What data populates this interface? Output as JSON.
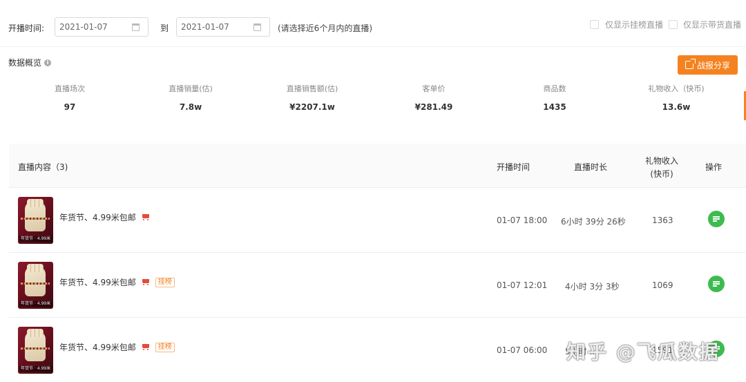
{
  "filters": {
    "start_label": "开播时间:",
    "start_date": "2021-01-07",
    "to_label": "到",
    "end_date": "2021-01-07",
    "hint": "(请选择近6个月内的直播)",
    "checkbox_1": "仅显示挂榜直播",
    "checkbox_2": "仅显示带货直播"
  },
  "overview": {
    "title": "数据概览",
    "share_label": "战报分享",
    "stats": [
      {
        "label": "直播场次",
        "value": "97"
      },
      {
        "label": "直播销量(估)",
        "value": "7.8w"
      },
      {
        "label": "直播销售额(估)",
        "value": "¥2207.1w"
      },
      {
        "label": "客单价",
        "value": "¥281.49"
      },
      {
        "label": "商品数",
        "value": "1435"
      },
      {
        "label": "礼物收入（快币)",
        "value": "13.6w"
      }
    ]
  },
  "table": {
    "headers": {
      "content": "直播内容（3)",
      "start_time": "开播时间",
      "duration": "直播时长",
      "gift_line1": "礼物收入",
      "gift_line2": "(快币)",
      "action": "操作"
    },
    "rows": [
      {
        "title": "年货节、4.99米包邮",
        "badge": "",
        "start": "01-07 18:00",
        "duration": "6小时 39分 26秒",
        "gift": "1363",
        "thumb_tag": "年货节 · 4.99米"
      },
      {
        "title": "年货节、4.99米包邮",
        "badge": "挂榜",
        "start": "01-07 12:01",
        "duration": "4小时 3分 3秒",
        "gift": "1069",
        "thumb_tag": "年货节 · 4.99米"
      },
      {
        "title": "年货节、4.99米包邮",
        "badge": "挂榜",
        "start": "01-07 06:00",
        "duration": "5小时 ...",
        "gift": "1591",
        "thumb_tag": "年货节 · 4.99米"
      }
    ]
  },
  "watermark": "知乎 @飞瓜数据",
  "colors": {
    "accent": "#f58220",
    "action_green": "#3dbb4f",
    "cart_red": "#e34b3b"
  },
  "icons": [
    "calendar-icon",
    "info-icon",
    "share-icon",
    "cart-icon",
    "list-icon"
  ]
}
